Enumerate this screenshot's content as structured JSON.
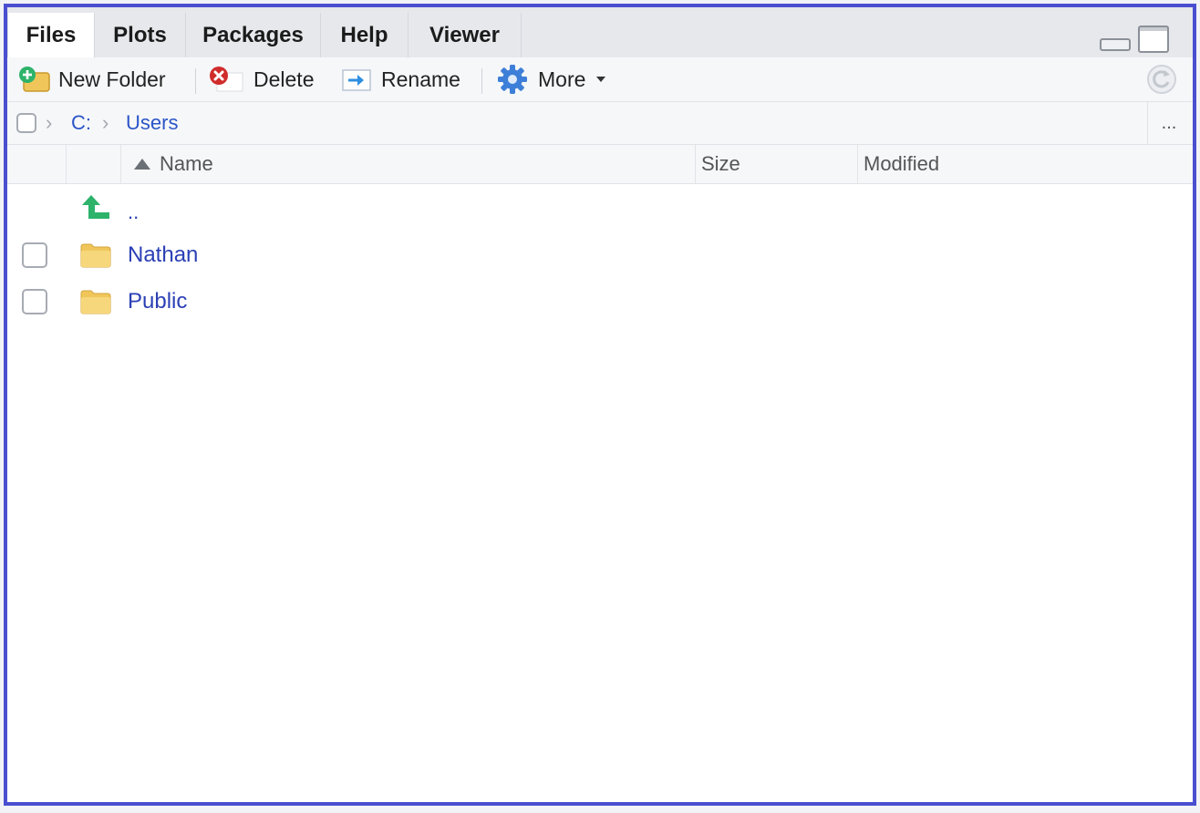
{
  "tabs": [
    {
      "label": "Files",
      "active": true
    },
    {
      "label": "Plots",
      "active": false
    },
    {
      "label": "Packages",
      "active": false
    },
    {
      "label": "Help",
      "active": false
    },
    {
      "label": "Viewer",
      "active": false
    }
  ],
  "toolbar": {
    "new_folder": "New Folder",
    "delete": "Delete",
    "rename": "Rename",
    "more": "More"
  },
  "path": {
    "crumbs": [
      "C:",
      "Users"
    ],
    "more": "..."
  },
  "table": {
    "columns": [
      "Name",
      "Size",
      "Modified"
    ],
    "sort_column": "Name",
    "sort_direction": "ascending",
    "parent_label": "..",
    "rows": [
      {
        "name": "Nathan",
        "type": "folder",
        "size": "",
        "modified": ""
      },
      {
        "name": "Public",
        "type": "folder",
        "size": "",
        "modified": ""
      }
    ]
  },
  "colors": {
    "frame": "#4a4fd0",
    "link": "#2b3fb5",
    "folder": "#f0c65a",
    "parent_arrow": "#2db36a",
    "delete_icon": "#d02c2c",
    "gear_icon": "#3d7fd8"
  }
}
